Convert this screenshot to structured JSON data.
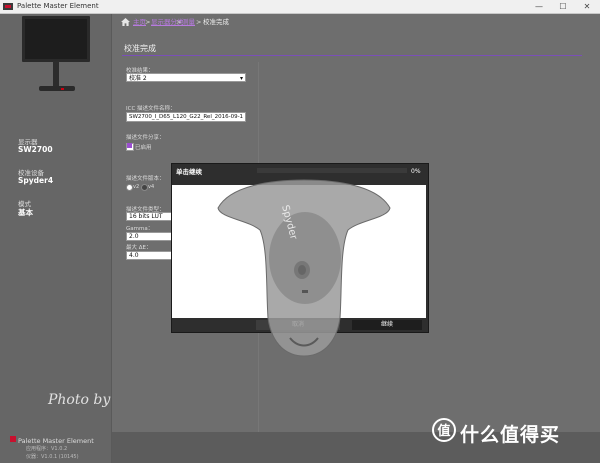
{
  "window": {
    "title": "Palette Master Element",
    "min": "—",
    "max": "☐",
    "close": "✕"
  },
  "breadcrumb": {
    "home": "主页",
    "step1": "显示器分类",
    "step2": "测量",
    "current": "校准完成",
    "sep": ">"
  },
  "sidebar": {
    "display_label": "显示器",
    "display_value": "SW2700",
    "device_label": "校准设备",
    "device_value": "Spyder4",
    "mode_label": "模式",
    "mode_value": "基本",
    "brand": "Palette Master Element",
    "ver1": "应用程序：V1.0.2",
    "ver2": "仪器：V1.0.1 (10145)"
  },
  "watermark": "Photo by WeiSC",
  "page": {
    "title": "校准完成"
  },
  "form": {
    "profile_name_label": "校准结果：",
    "profile_name_value": "校准 2",
    "icc_label": "ICC 描述文件名称：",
    "icc_value": "SW2700_I_D65_L120_G22_Rel_2016-09-1",
    "share_label": "描述文件分享：",
    "share_checkbox": "已启用",
    "version_label": "描述文件版本：",
    "v2": "v2",
    "v4": "v4",
    "type_label": "描述文件类型：",
    "type_value": "16 bits LUT",
    "gamma_label": "Gamma：",
    "gamma_value": "2.0",
    "max_label": "最大 ΔE：",
    "max_value": "4.0"
  },
  "dialog": {
    "title": "单击继续",
    "progress_percent": 0,
    "progress_text": "0%",
    "cancel": "取消",
    "continue": "继续"
  },
  "site_watermark": "什么值得买",
  "colors": {
    "accent": "#9b4fd0",
    "progress": "#3fb34f",
    "panel": "#6e6e6e"
  }
}
